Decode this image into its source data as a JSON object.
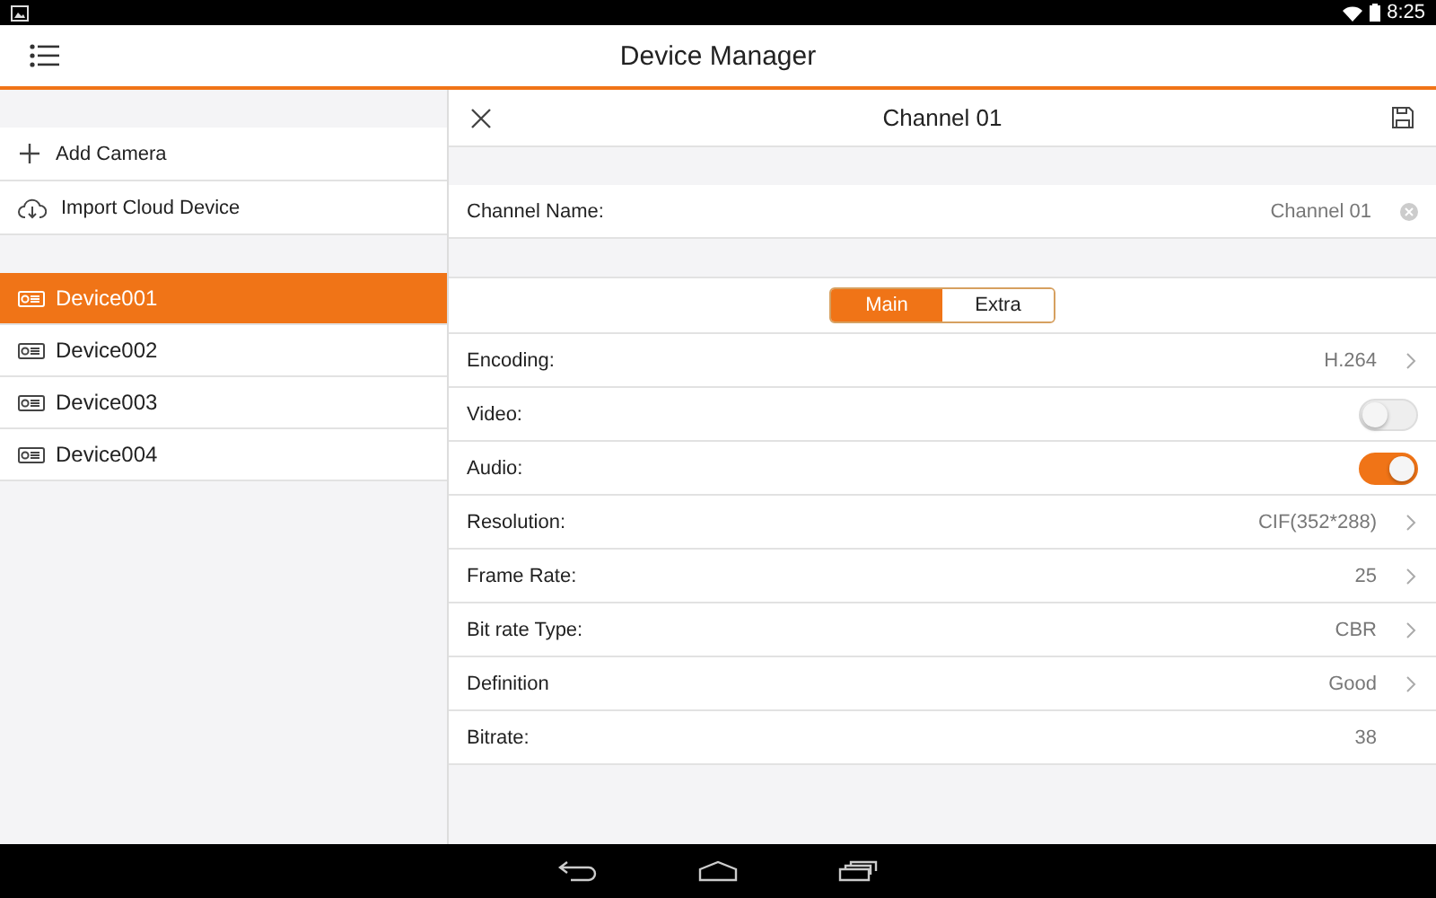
{
  "status_bar": {
    "time": "8:25"
  },
  "app_bar": {
    "title": "Device Manager"
  },
  "sidebar": {
    "actions": [
      {
        "kind": "add",
        "label": "Add Camera"
      },
      {
        "kind": "cloud",
        "label": "Import Cloud Device"
      }
    ],
    "devices": [
      {
        "name": "Device001",
        "selected": true
      },
      {
        "name": "Device002",
        "selected": false
      },
      {
        "name": "Device003",
        "selected": false
      },
      {
        "name": "Device004",
        "selected": false
      }
    ]
  },
  "panel": {
    "title": "Channel 01",
    "channel_name": {
      "label": "Channel Name:",
      "value": "Channel 01"
    },
    "streams": [
      {
        "label": "Main",
        "selected": true
      },
      {
        "label": "Extra",
        "selected": false
      }
    ],
    "settings": [
      {
        "kind": "select",
        "label": "Encoding:",
        "value": "H.264"
      },
      {
        "kind": "toggle",
        "label": "Video:",
        "on": false
      },
      {
        "kind": "toggle",
        "label": "Audio:",
        "on": true
      },
      {
        "kind": "select",
        "label": "Resolution:",
        "value": "CIF(352*288)"
      },
      {
        "kind": "select",
        "label": "Frame Rate:",
        "value": "25"
      },
      {
        "kind": "select",
        "label": "Bit rate Type:",
        "value": "CBR"
      },
      {
        "kind": "select",
        "label": "Definition",
        "value": "Good"
      },
      {
        "kind": "text",
        "label": "Bitrate:",
        "value": "38"
      }
    ]
  }
}
